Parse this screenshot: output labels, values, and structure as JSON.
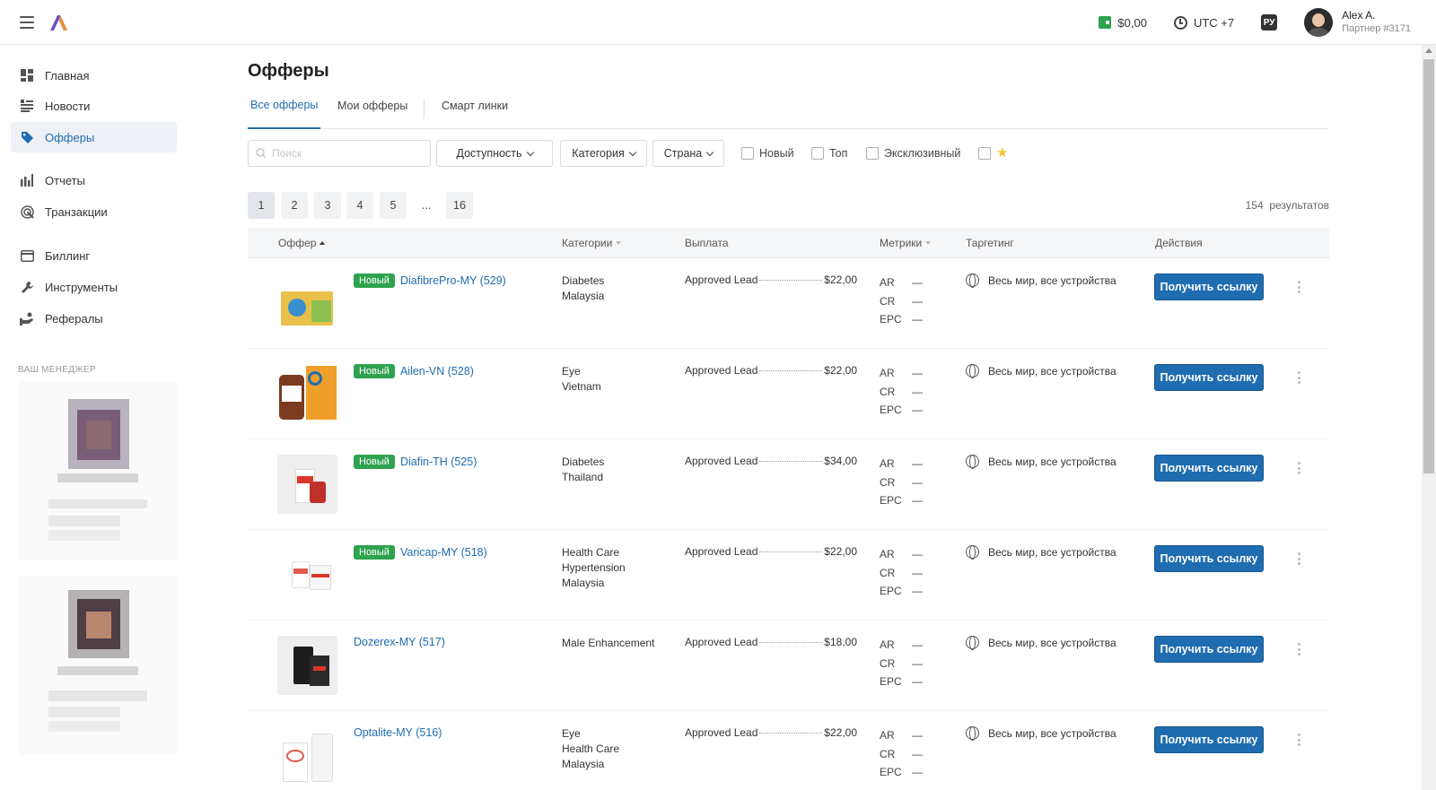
{
  "header": {
    "balance": "$0,00",
    "timezone": "UTC +7",
    "lang": "РУ",
    "user_name": "Alex A.",
    "user_partner": "Партнер #3171"
  },
  "sidebar": {
    "items": [
      {
        "label": "Главная",
        "icon": "dashboard-icon"
      },
      {
        "label": "Новости",
        "icon": "news-icon"
      },
      {
        "label": "Офферы",
        "icon": "tag-icon"
      },
      {
        "label": "Отчеты",
        "icon": "bar-chart-icon"
      },
      {
        "label": "Транзакции",
        "icon": "transactions-icon"
      },
      {
        "label": "Биллинг",
        "icon": "card-icon"
      },
      {
        "label": "Инструменты",
        "icon": "wrench-icon"
      },
      {
        "label": "Рефералы",
        "icon": "referrals-icon"
      }
    ],
    "active_index": 2,
    "manager_label": "ВАШ МЕНЕДЖЕР"
  },
  "main": {
    "title": "Офферы",
    "tabs": [
      "Все офферы",
      "Мои офферы",
      "Смарт линки"
    ],
    "active_tab": 0,
    "search_placeholder": "Поиск",
    "filters": {
      "availability": "Доступность",
      "category": "Категория",
      "country": "Страна",
      "checkbox_new": "Новый",
      "checkbox_top": "Топ",
      "checkbox_exclusive": "Эксклюзивный"
    },
    "pages": [
      "1",
      "2",
      "3",
      "4",
      "5",
      "...",
      "16"
    ],
    "active_page": "1",
    "results_count": "154",
    "results_label": "результатов",
    "columns": {
      "offer": "Оффер",
      "categories": "Категории",
      "payout": "Выплата",
      "metrics": "Метрики",
      "targeting": "Таргетинг",
      "actions": "Действия"
    },
    "new_badge": "Новый",
    "get_link_label": "Получить ссылку",
    "payout_type": "Approved Lead",
    "metric_keys": [
      "AR",
      "CR",
      "EPC"
    ],
    "metric_placeholder": "—",
    "targeting_text": "Весь мир, все устройства",
    "rows": [
      {
        "name": "DiafibrePro-MY (529)",
        "is_new": true,
        "categories": [
          "Diabetes",
          "Malaysia"
        ],
        "payout": "$22,00"
      },
      {
        "name": "Ailen-VN (528)",
        "is_new": true,
        "categories": [
          "Eye",
          "Vietnam"
        ],
        "payout": "$22,00"
      },
      {
        "name": "Diafin-TH (525)",
        "is_new": true,
        "categories": [
          "Diabetes",
          "Thailand"
        ],
        "payout": "$34,00"
      },
      {
        "name": "Varicap-MY (518)",
        "is_new": true,
        "categories": [
          "Health Care",
          "Hypertension",
          "Malaysia"
        ],
        "payout": "$22,00"
      },
      {
        "name": "Dozerex-MY (517)",
        "is_new": false,
        "categories": [
          "Male Enhancement"
        ],
        "payout": "$18,00"
      },
      {
        "name": "Optalite-MY (516)",
        "is_new": false,
        "categories": [
          "Eye",
          "Health Care",
          "Malaysia"
        ],
        "payout": "$22,00"
      }
    ]
  },
  "colors": {
    "accent": "#1f6cb0",
    "new_badge": "#2fa24f",
    "active_nav_bg": "#eef1f6"
  }
}
